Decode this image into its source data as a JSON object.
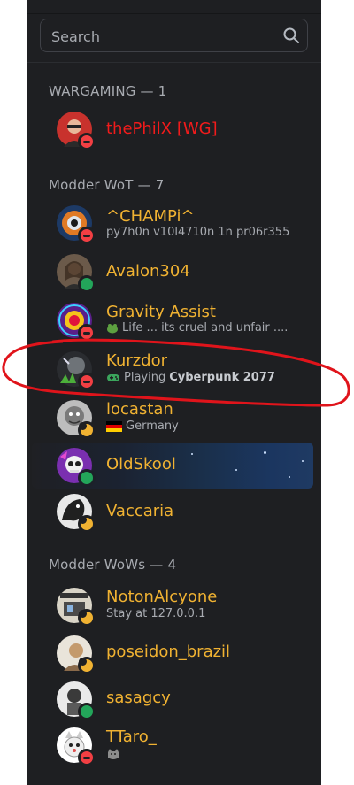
{
  "search": {
    "placeholder": "Search"
  },
  "sections": [
    {
      "label": "WARGAMING — 1",
      "members": [
        {
          "name": "thePhilX [WG]",
          "status": "dnd",
          "color": "#f21b1b"
        }
      ]
    },
    {
      "label": "Modder WoT — 7",
      "members": [
        {
          "name": "^CHAMPi^",
          "status": "dnd",
          "activity": "py7h0n v10l4710n 1n pr06r355"
        },
        {
          "name": "Avalon304",
          "status": "online"
        },
        {
          "name": "Gravity Assist",
          "status": "dnd",
          "activity": "Life ... its cruel and unfair ...."
        },
        {
          "name": "Kurzdor",
          "status": "dnd",
          "activity_prefix": "Playing",
          "activity_game": "Cyberpunk 2077",
          "activity_icon": "gamepad-icon"
        },
        {
          "name": "locastan",
          "status": "idle",
          "activity": "Germany",
          "activity_icon": "germany-flag-icon"
        },
        {
          "name": "OldSkool",
          "status": "online",
          "highlighted": true
        },
        {
          "name": "Vaccaria",
          "status": "idle"
        }
      ]
    },
    {
      "label": "Modder WoWs — 4",
      "members": [
        {
          "name": "NotonAlcyone",
          "status": "idle",
          "activity": "Stay at 127.0.0.1"
        },
        {
          "name": "poseidon_brazil",
          "status": "idle"
        },
        {
          "name": "sasagcy",
          "status": "online"
        },
        {
          "name": "TTaro_",
          "status": "dnd",
          "activity_icon": "cat-emoji-icon"
        }
      ]
    }
  ],
  "colors": {
    "background": "#1e1f22",
    "name_default": "#f0b232",
    "name_staff": "#f21b1b",
    "status_dnd": "#f23f43",
    "status_online": "#23a55a",
    "status_idle": "#f0b232",
    "annotation": "#e0141b"
  }
}
